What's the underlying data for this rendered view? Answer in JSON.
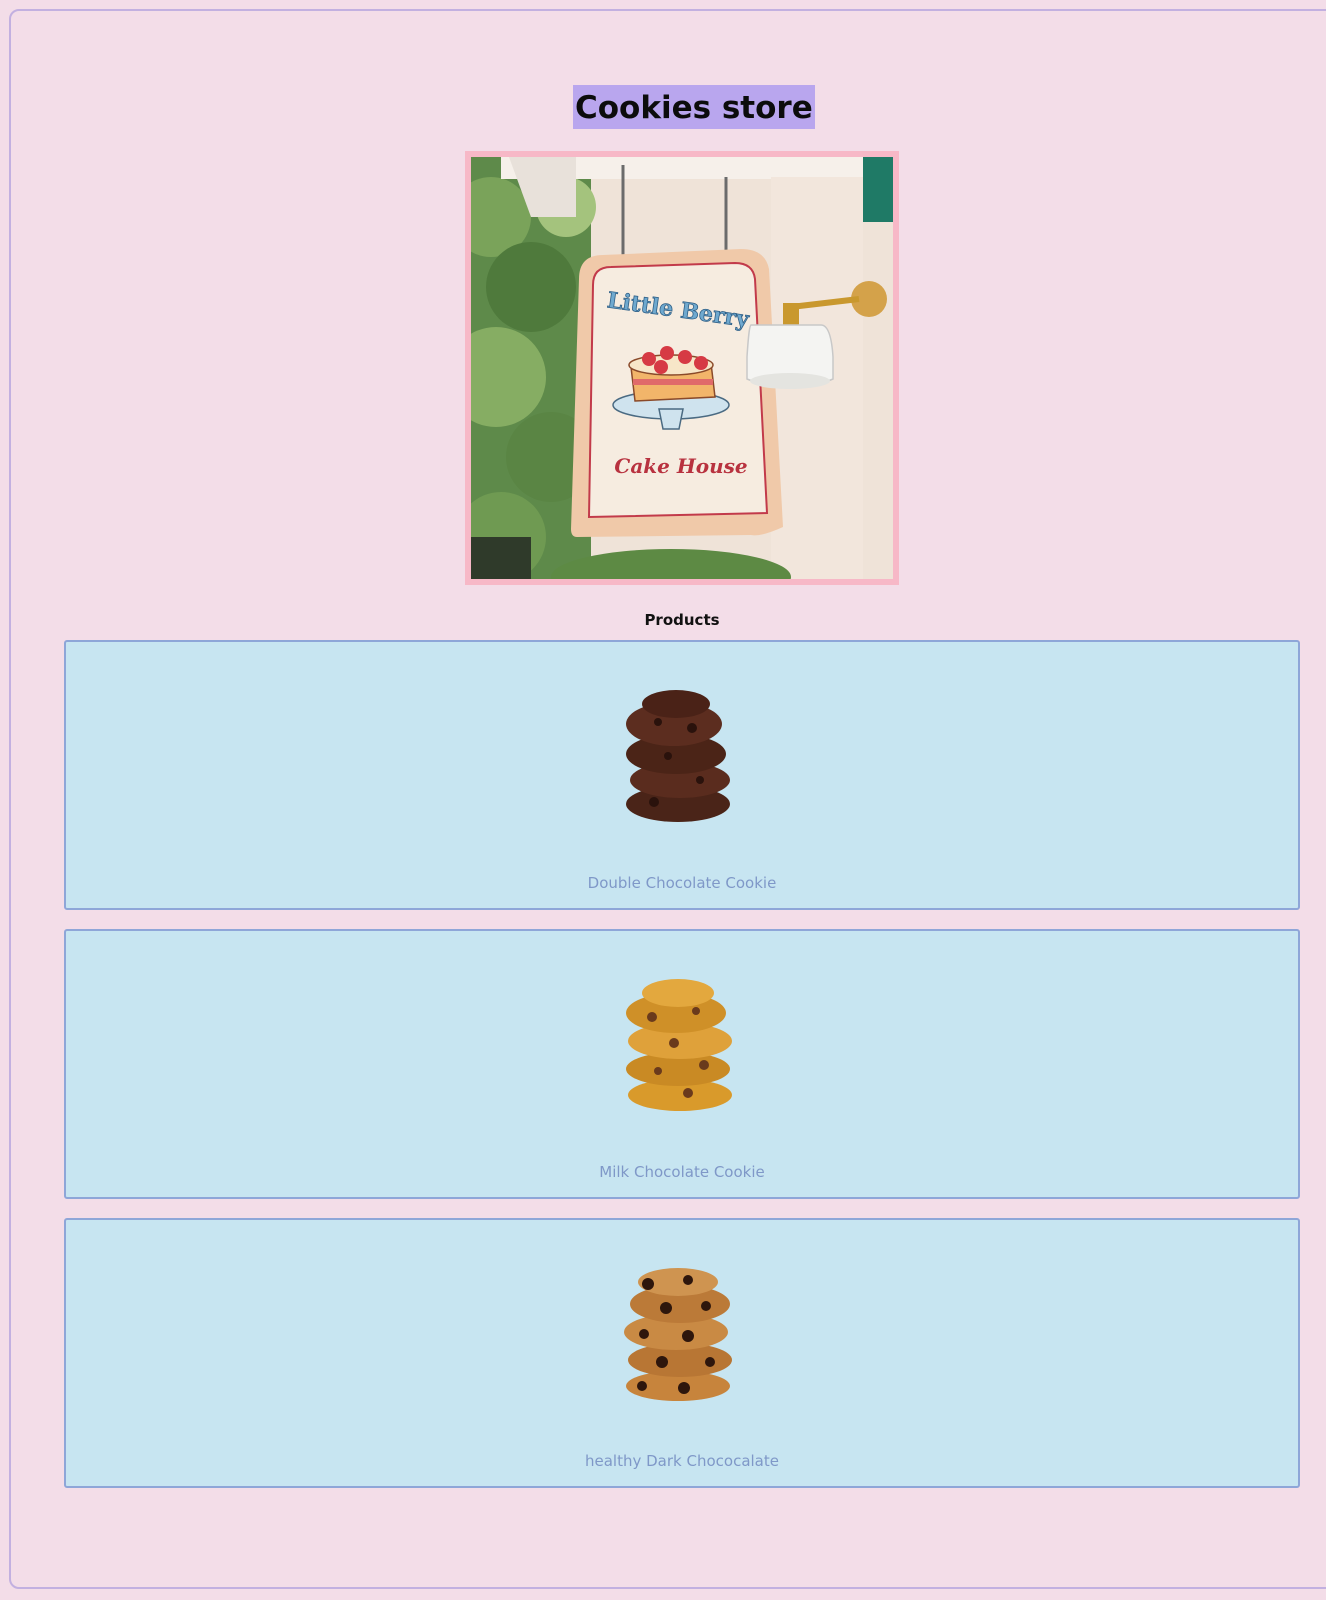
{
  "page": {
    "title": "Cookies store",
    "hero_image": {
      "description_icon": "storefront-sign-image",
      "sign_text_top": "Little Berry",
      "sign_text_bottom": "Cake House"
    },
    "products_heading": "Products"
  },
  "products": [
    {
      "name": "Double Chocolate Cookie",
      "image_icon": "double-chocolate-cookie-image"
    },
    {
      "name": "Milk Chocolate Cookie",
      "image_icon": "milk-chocolate-cookie-image"
    },
    {
      "name": "healthy Dark Chococalate",
      "image_icon": "dark-chocolate-cookie-image"
    }
  ],
  "colors": {
    "background": "#f3dde8",
    "title_highlight": "#b9a6ee",
    "card_background": "#c7e5f1",
    "card_border": "#8ea6d8",
    "product_name": "#7f98c8",
    "hero_border": "#f7b8c7"
  }
}
